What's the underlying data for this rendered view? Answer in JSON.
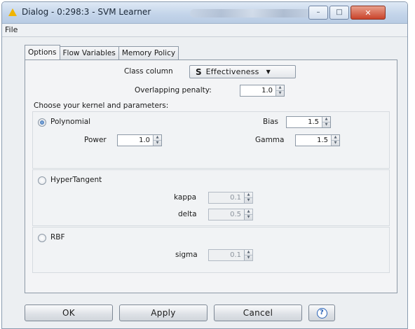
{
  "window": {
    "title": "Dialog - 0:298:3 - SVM Learner",
    "controls": {
      "minimize": "–",
      "maximize": "□",
      "close": "✕"
    }
  },
  "menu": {
    "file": "File"
  },
  "tabs": [
    {
      "label": "Options",
      "active": true
    },
    {
      "label": "Flow Variables",
      "active": false
    },
    {
      "label": "Memory Policy",
      "active": false
    }
  ],
  "options": {
    "class_column_label": "Class column",
    "class_column_type": "S",
    "class_column_value": "Effectiveness",
    "overlapping_penalty_label": "Overlapping penalty:",
    "overlapping_penalty_value": "1.0",
    "kernel_heading": "Choose your kernel and parameters:",
    "polynomial": {
      "label": "Polynomial",
      "selected": true,
      "bias_label": "Bias",
      "bias_value": "1.5",
      "power_label": "Power",
      "power_value": "1.0",
      "gamma_label": "Gamma",
      "gamma_value": "1.5"
    },
    "hypertangent": {
      "label": "HyperTangent",
      "selected": false,
      "kappa_label": "kappa",
      "kappa_value": "0.1",
      "delta_label": "delta",
      "delta_value": "0.5"
    },
    "rbf": {
      "label": "RBF",
      "selected": false,
      "sigma_label": "sigma",
      "sigma_value": "0.1"
    }
  },
  "buttons": {
    "ok": "OK",
    "apply": "Apply",
    "cancel": "Cancel",
    "help": "?"
  },
  "colors": {
    "accent": "#2d5fa3",
    "titlebar": "#c4d5ea",
    "close": "#c9432b"
  }
}
